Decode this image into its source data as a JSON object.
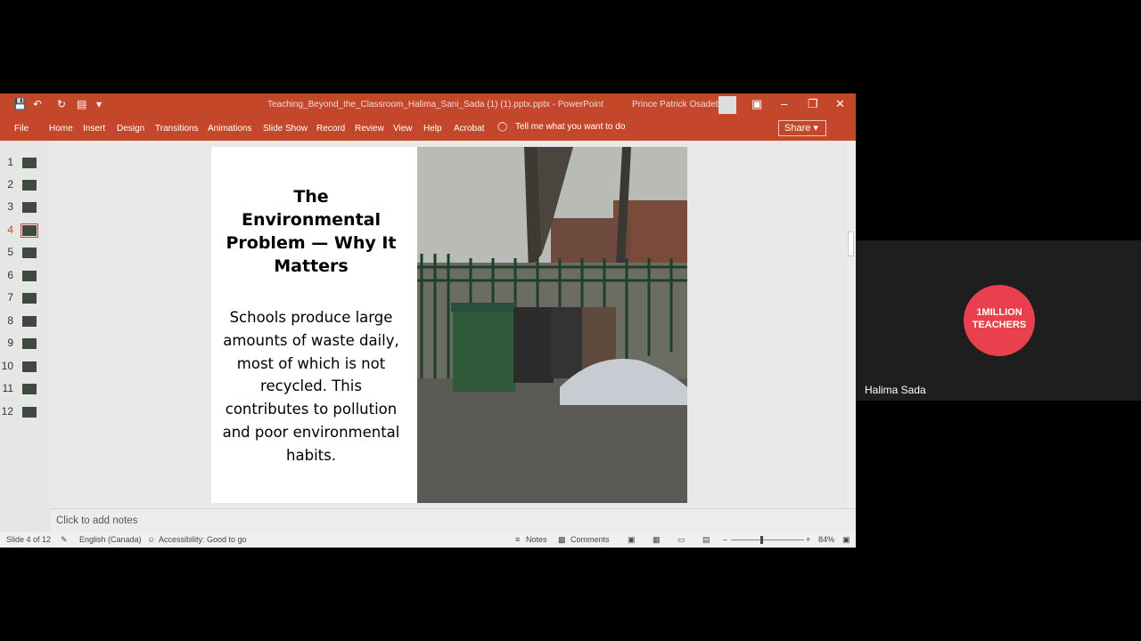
{
  "window": {
    "title": "Teaching_Beyond_the_Classroom_Halima_Sani_Sada (1) (1).pptx.pptx  -  PowerPoint",
    "user": "Prince Patrick Osadebey"
  },
  "ribbon": {
    "tabs": [
      "File",
      "Home",
      "Insert",
      "Design",
      "Transitions",
      "Animations",
      "Slide Show",
      "Record",
      "Review",
      "View",
      "Help",
      "Acrobat"
    ],
    "tell_me": "Tell me what you want to do",
    "share": "Share"
  },
  "thumbnails": [
    "1",
    "2",
    "3",
    "4",
    "5",
    "6",
    "7",
    "8",
    "9",
    "10",
    "11",
    "12"
  ],
  "active_slide": 4,
  "slide": {
    "title": "The Environmental Problem — Why It Matters",
    "body": "Schools produce large amounts of waste daily, most of which is not recycled. This contributes to pollution and poor environmental habits."
  },
  "notes_placeholder": "Click to add notes",
  "status": {
    "slide_of": "Slide 4 of 12",
    "language": "English (Canada)",
    "accessibility": "Accessibility: Good to go",
    "notes": "Notes",
    "comments": "Comments",
    "zoom": "84%"
  },
  "participant": {
    "logo_line1": "1MILLION",
    "logo_line2": "TEACHERS",
    "name": "Halima Sada"
  },
  "colors": {
    "accent": "#c4472b",
    "logo": "#e8414d"
  },
  "icons": [
    "save-icon",
    "undo-icon",
    "redo-icon",
    "present-icon",
    "lightbulb-icon",
    "minimize-icon",
    "restore-icon",
    "close-icon"
  ]
}
